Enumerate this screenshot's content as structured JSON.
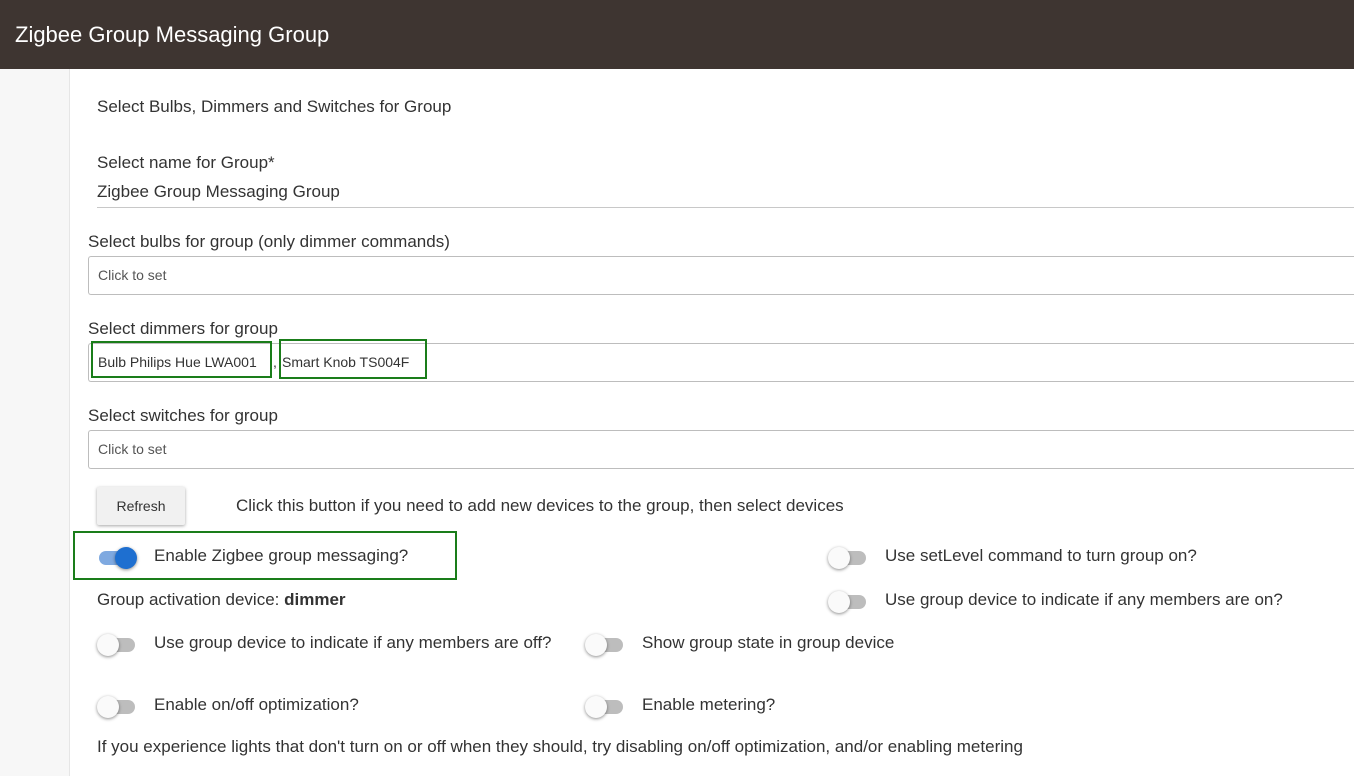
{
  "header": {
    "title": "Zigbee Group Messaging Group"
  },
  "section": {
    "title": "Select Bulbs, Dimmers and Switches for Group"
  },
  "group_name": {
    "label": "Select name for Group*",
    "value": "Zigbee Group Messaging Group"
  },
  "bulbs": {
    "label": "Select bulbs for group (only dimmer commands)",
    "value": "Click to set"
  },
  "dimmers": {
    "label": "Select dimmers for group",
    "items": [
      "Bulb Philips Hue LWA001",
      "Smart Knob TS004F"
    ],
    "separator": ","
  },
  "switches": {
    "label": "Select switches for group",
    "value": "Click to set"
  },
  "refresh": {
    "label": "Refresh",
    "hint": "Click this button if you need to add new devices to the group, then select devices"
  },
  "toggles": {
    "enable_group_messaging": {
      "label": "Enable Zigbee group messaging?",
      "on": true
    },
    "use_setlevel": {
      "label": "Use setLevel command to turn group on?",
      "on": false
    },
    "indicate_any_on": {
      "label": "Use group device to indicate if any members are on?",
      "on": false
    },
    "indicate_any_off": {
      "label": "Use group device to indicate if any members are off?",
      "on": false
    },
    "show_group_state": {
      "label": "Show group state in group device",
      "on": false
    },
    "onoff_optimization": {
      "label": "Enable on/off optimization?",
      "on": false
    },
    "metering": {
      "label": "Enable metering?",
      "on": false
    }
  },
  "activation": {
    "label": "Group activation device:",
    "value": "dimmer"
  },
  "footer_note": "If you experience lights that don't turn on or off when they should, try disabling on/off optimization, and/or enabling metering",
  "colors": {
    "header_bg": "#3e3531",
    "toggle_on": "#1e6fd0",
    "highlight": "#1a7d1a"
  }
}
